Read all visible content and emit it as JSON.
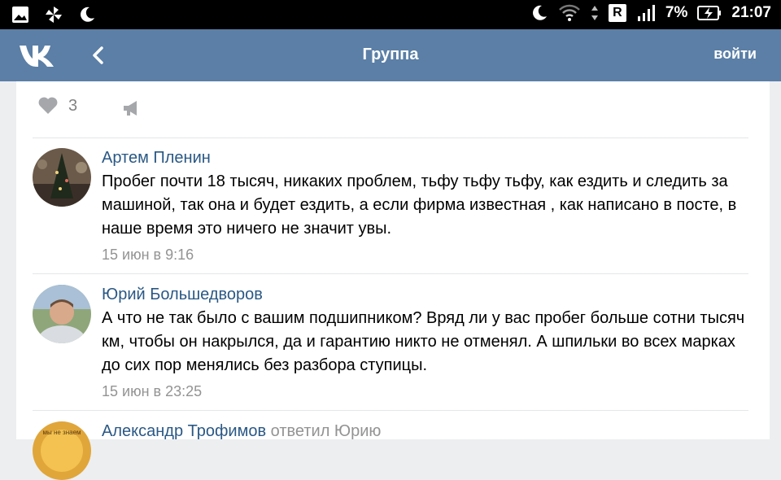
{
  "status_bar": {
    "battery": "7%",
    "time": "21:07",
    "roaming_badge": "R"
  },
  "header": {
    "title": "Группа",
    "login": "войти"
  },
  "post_actions": {
    "likes": "3"
  },
  "comments": [
    {
      "author": "Артем Пленин",
      "text": "Пробег почти 18 тысяч, никаких проблем, тьфу тьфу тьфу, как ездить и следить за машиной, так она и будет ездить, а если фирма известная , как написано в посте, в наше время это ничего не значит увы.",
      "time": "15 июн в 9:16"
    },
    {
      "author": "Юрий Большедворов",
      "text": "А что не так было с вашим подшипником? Вряд ли у вас пробег больше сотни тысяч км, чтобы он накрылся, да и гарантию никто не отменял. А шпильки во всех марках до сих пор менялись без разбора ступицы.",
      "time": "15 июн в 23:25"
    },
    {
      "author": "Александр Трофимов",
      "reply_to": "ответил Юрию",
      "avatar_text": "мы не знаем"
    }
  ]
}
